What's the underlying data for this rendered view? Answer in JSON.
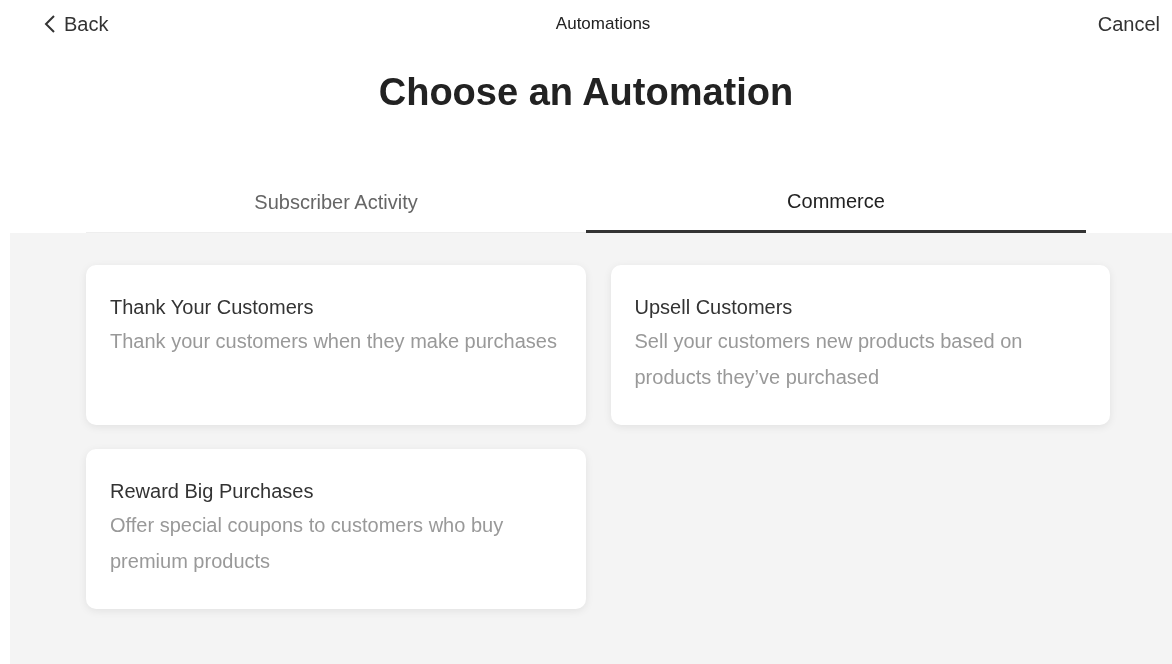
{
  "header": {
    "back": "Back",
    "title": "Automations",
    "cancel": "Cancel"
  },
  "heading": "Choose an Automation",
  "tabs": [
    {
      "label": "Subscriber Activity",
      "selected": false
    },
    {
      "label": "Commerce",
      "selected": true
    }
  ],
  "cards": [
    {
      "title": "Thank Your Customers",
      "description": "Thank your customers when they make purchases"
    },
    {
      "title": "Upsell Customers",
      "description": "Sell your customers new products based on products they’ve purchased"
    },
    {
      "title": "Reward Big Purchases",
      "description": "Offer special coupons to customers who buy premium products"
    }
  ]
}
